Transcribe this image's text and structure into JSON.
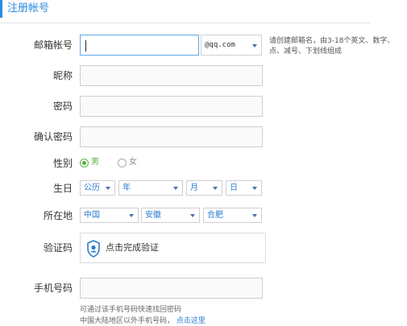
{
  "header": {
    "title": "注册帐号"
  },
  "form": {
    "email": {
      "label": "邮箱帐号",
      "value": "",
      "domain": "@qq.com"
    },
    "email_hint": "请创建邮箱名，由3-18个英文、数字、点、减号、下划线组成",
    "nickname": {
      "label": "昵称",
      "value": ""
    },
    "password": {
      "label": "密码",
      "value": ""
    },
    "confirm_password": {
      "label": "确认密码",
      "value": ""
    },
    "gender": {
      "label": "性别",
      "options": [
        "男",
        "女"
      ],
      "selected": "男"
    },
    "birthday": {
      "label": "生日",
      "calendar": "公历",
      "year": "年",
      "month": "月",
      "day": "日"
    },
    "location": {
      "label": "所在地",
      "country": "中国",
      "province": "安徽",
      "city": "合肥"
    },
    "captcha": {
      "label": "验证码",
      "button_text": "点击完成验证"
    },
    "phone": {
      "label": "手机号码",
      "value": ""
    },
    "phone_note_line1": "可通过该手机号码快速找回密码",
    "phone_note_line2": "中国大陆地区以外手机号码",
    "phone_note_link": "点击这里"
  },
  "colors": {
    "accent": "#2a8be0",
    "radio_checked": "#59b24a",
    "link": "#2a7bd0"
  }
}
